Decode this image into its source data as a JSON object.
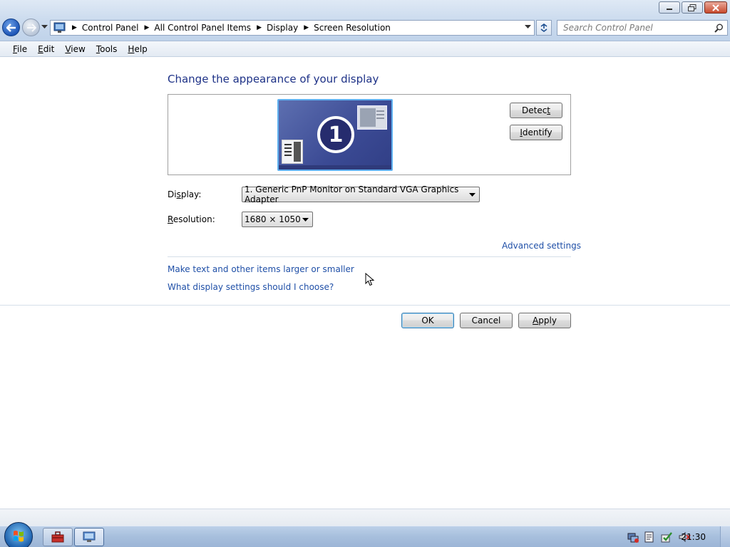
{
  "window": {
    "controls": [
      "minimize-icon",
      "restore-icon",
      "close-icon"
    ]
  },
  "address": {
    "crumbs": [
      "Control Panel",
      "All Control Panel Items",
      "Display",
      "Screen Resolution"
    ],
    "search_placeholder": "Search Control Panel"
  },
  "menu": {
    "file_u": "F",
    "file_rest": "ile",
    "edit_u": "E",
    "edit_rest": "dit",
    "view_u": "V",
    "view_rest": "iew",
    "tools_u": "T",
    "tools_rest": "ools",
    "help_u": "H",
    "help_rest": "elp"
  },
  "main": {
    "heading": "Change the appearance of your display",
    "monitor_number": "1",
    "detect_pre": "Detec",
    "detect_u": "t",
    "identify_u": "I",
    "identify_rest": "dentify",
    "display_label_pre": "Di",
    "display_label_u": "s",
    "display_label_rest": "play:",
    "display_value": "1. Generic PnP Monitor on Standard VGA Graphics Adapter",
    "resolution_label_u": "R",
    "resolution_label_rest": "esolution:",
    "resolution_value": "1680 × 1050",
    "advanced_link": "Advanced settings",
    "text_size_link": "Make text and other items larger or smaller",
    "settings_help_link": "What display settings should I choose?"
  },
  "buttons": {
    "ok": "OK",
    "cancel": "Cancel",
    "apply_u": "A",
    "apply_rest": "pply"
  },
  "taskbar": {
    "clock": "21:30"
  },
  "colors": {
    "heading": "#1e3287",
    "link": "#1f4fa7",
    "accent": "#5fb1f0"
  }
}
